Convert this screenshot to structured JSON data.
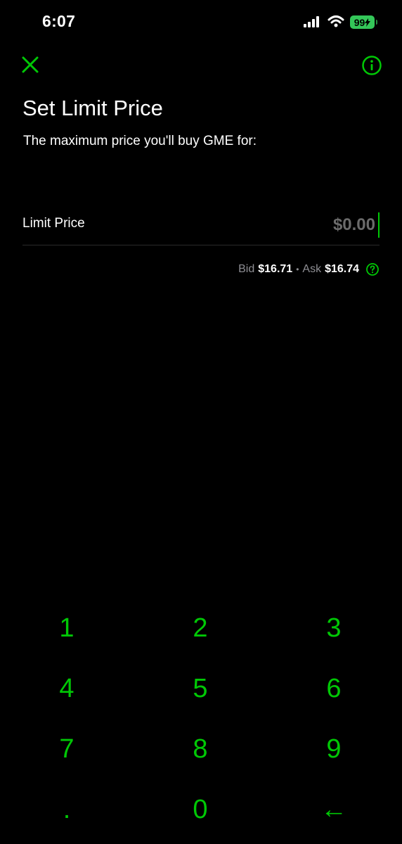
{
  "status_bar": {
    "time": "6:07",
    "battery": "99",
    "icons": [
      "signal-icon",
      "wifi-icon",
      "battery-icon"
    ]
  },
  "header": {
    "close_icon": "close-icon",
    "info_icon": "info-icon"
  },
  "title": "Set Limit Price",
  "subtitle": "The maximum price you'll buy GME for:",
  "limit_field": {
    "label": "Limit Price",
    "value": "",
    "placeholder": "$0.00"
  },
  "quote": {
    "bid_label": "Bid",
    "bid_value": "$16.71",
    "separator": "•",
    "ask_label": "Ask",
    "ask_value": "$16.74",
    "help_icon": "help-circle-icon"
  },
  "keypad": {
    "keys": [
      "1",
      "2",
      "3",
      "4",
      "5",
      "6",
      "7",
      "8",
      "9",
      ".",
      "0",
      "←"
    ]
  },
  "colors": {
    "accent": "#00c805",
    "background": "#000000",
    "muted": "#8e8e93",
    "battery": "#34c759"
  }
}
